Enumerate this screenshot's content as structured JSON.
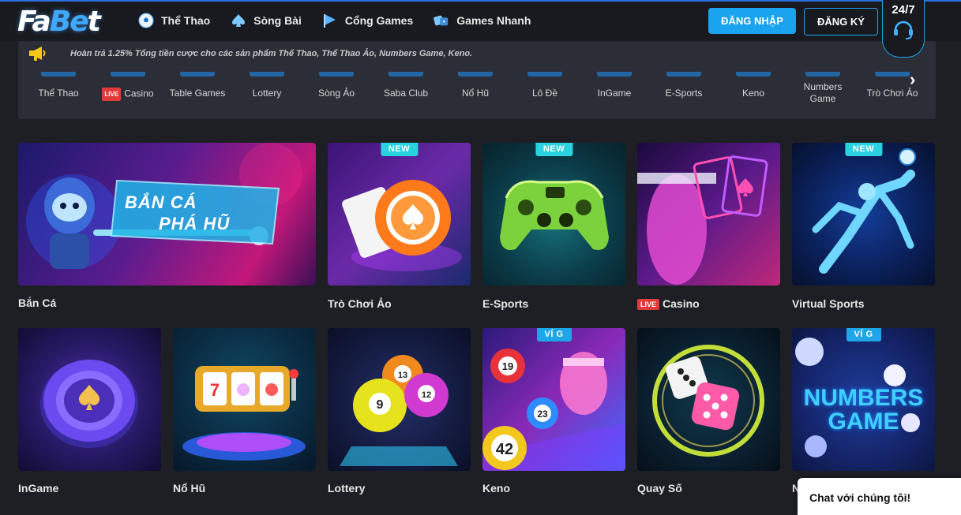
{
  "header": {
    "logo_a": "Fa",
    "logo_b": "Be",
    "logo_c": "t",
    "nav": [
      {
        "label": "Thể Thao",
        "icon": "soccer-ball-icon"
      },
      {
        "label": "Sòng Bài",
        "icon": "spade-icon"
      },
      {
        "label": "Cổng Games",
        "icon": "play-flag-icon"
      },
      {
        "label": "Games Nhanh",
        "icon": "dice-icon"
      }
    ],
    "login_label": "ĐĂNG NHẬP",
    "register_label": "ĐĂNG KÝ",
    "support_label": "24/7",
    "support_icon": "headset-icon"
  },
  "marquee": {
    "icon": "megaphone-icon",
    "text": "Hoàn trả 1.25% Tổng tiền cược cho các sản phẩm Thể Thao, Thể Thao Ảo, Numbers Game, Keno."
  },
  "categories": [
    {
      "label": "Thể Thao"
    },
    {
      "label": "Casino",
      "badge": "LIVE"
    },
    {
      "label": "Table Games"
    },
    {
      "label": "Lottery"
    },
    {
      "label": "Sòng Ảo"
    },
    {
      "label": "Saba Club"
    },
    {
      "label": "Nổ Hũ"
    },
    {
      "label": "Lô Đề"
    },
    {
      "label": "InGame"
    },
    {
      "label": "E-Sports"
    },
    {
      "label": "Keno"
    },
    {
      "label": "Numbers Game"
    },
    {
      "label": "Trò Chơi Ảo"
    }
  ],
  "tiles": {
    "ban_ca": {
      "label": "Bắn Cá",
      "banner_line1": "BẮN CÁ",
      "banner_line2": "PHÁ HŨ"
    },
    "tro_choi_ao": {
      "label": "Trò Chơi Ảo",
      "badge": "NEW"
    },
    "esports": {
      "label": "E-Sports",
      "badge": "NEW"
    },
    "casino": {
      "label": "Casino",
      "live": "LIVE"
    },
    "virtual_sports": {
      "label": "Virtual Sports",
      "badge": "NEW"
    },
    "ingame": {
      "label": "InGame"
    },
    "no_hu": {
      "label": "Nổ Hũ"
    },
    "lottery": {
      "label": "Lottery",
      "ball_a": "13",
      "ball_b": "9",
      "ball_c": "12"
    },
    "keno": {
      "label": "Keno",
      "badge": "VÍ G",
      "ball_a": "19",
      "ball_b": "23",
      "ball_c": "42"
    },
    "quay_so": {
      "label": "Quay Số"
    },
    "numbers_game": {
      "label": "N",
      "badge": "VÍ G",
      "title_line1": "NUMBERS",
      "title_line2": "GAME"
    }
  },
  "chat": {
    "label": "Chat với chúng tôi!"
  }
}
